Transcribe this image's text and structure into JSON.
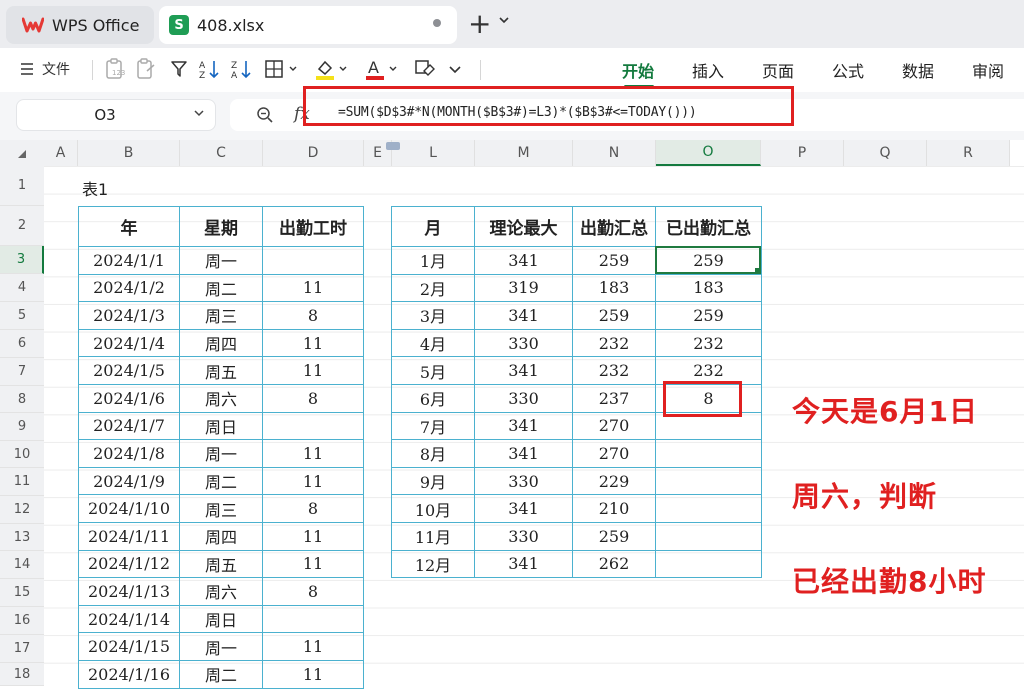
{
  "tabs": {
    "app_label": "WPS Office",
    "file_icon_letter": "S",
    "file_label": "408.xlsx"
  },
  "toolbar": {
    "file_menu": "文件",
    "menu_tabs": [
      "开始",
      "插入",
      "页面",
      "公式",
      "数据",
      "审阅"
    ],
    "active_tab": "开始"
  },
  "formula_bar": {
    "name_box": "O3",
    "fx": "fx",
    "formula": "=SUM($D$3#*N(MONTH($B$3#)=L3)*($B$3#<=TODAY()))"
  },
  "columns": [
    "A",
    "B",
    "C",
    "D",
    "E",
    "L",
    "M",
    "N",
    "O",
    "P",
    "Q",
    "R"
  ],
  "selected_column": "O",
  "rows": [
    "1",
    "2",
    "3",
    "4",
    "5",
    "6",
    "7",
    "8",
    "9",
    "10",
    "11",
    "12",
    "13",
    "14",
    "15",
    "16",
    "17",
    "18"
  ],
  "selected_row": "3",
  "sheet": {
    "table1_title": "表1",
    "table1_headers": [
      "年",
      "星期",
      "出勤工时"
    ],
    "table1_rows": [
      [
        "2024/1/1",
        "周一",
        ""
      ],
      [
        "2024/1/2",
        "周二",
        "11"
      ],
      [
        "2024/1/3",
        "周三",
        "8"
      ],
      [
        "2024/1/4",
        "周四",
        "11"
      ],
      [
        "2024/1/5",
        "周五",
        "11"
      ],
      [
        "2024/1/6",
        "周六",
        "8"
      ],
      [
        "2024/1/7",
        "周日",
        ""
      ],
      [
        "2024/1/8",
        "周一",
        "11"
      ],
      [
        "2024/1/9",
        "周二",
        "11"
      ],
      [
        "2024/1/10",
        "周三",
        "8"
      ],
      [
        "2024/1/11",
        "周四",
        "11"
      ],
      [
        "2024/1/12",
        "周五",
        "11"
      ],
      [
        "2024/1/13",
        "周六",
        "8"
      ],
      [
        "2024/1/14",
        "周日",
        ""
      ],
      [
        "2024/1/15",
        "周一",
        "11"
      ],
      [
        "2024/1/16",
        "周二",
        "11"
      ]
    ],
    "table2_headers": [
      "月",
      "理论最大",
      "出勤汇总",
      "已出勤汇总"
    ],
    "table2_rows": [
      [
        "1月",
        "341",
        "259",
        "259"
      ],
      [
        "2月",
        "319",
        "183",
        "183"
      ],
      [
        "3月",
        "341",
        "259",
        "259"
      ],
      [
        "4月",
        "330",
        "232",
        "232"
      ],
      [
        "5月",
        "341",
        "232",
        "232"
      ],
      [
        "6月",
        "330",
        "237",
        "8"
      ],
      [
        "7月",
        "341",
        "270",
        ""
      ],
      [
        "8月",
        "341",
        "270",
        ""
      ],
      [
        "9月",
        "330",
        "229",
        ""
      ],
      [
        "10月",
        "341",
        "210",
        ""
      ],
      [
        "11月",
        "330",
        "259",
        ""
      ],
      [
        "12月",
        "341",
        "262",
        ""
      ]
    ]
  },
  "annotations": {
    "line1": "今天是6月1日",
    "line2": "周六，判断",
    "line3": "已经出勤8小时"
  },
  "colors": {
    "accent_green": "#137a3e",
    "table_border": "#4bb1cf",
    "highlight_red": "#e02020"
  }
}
